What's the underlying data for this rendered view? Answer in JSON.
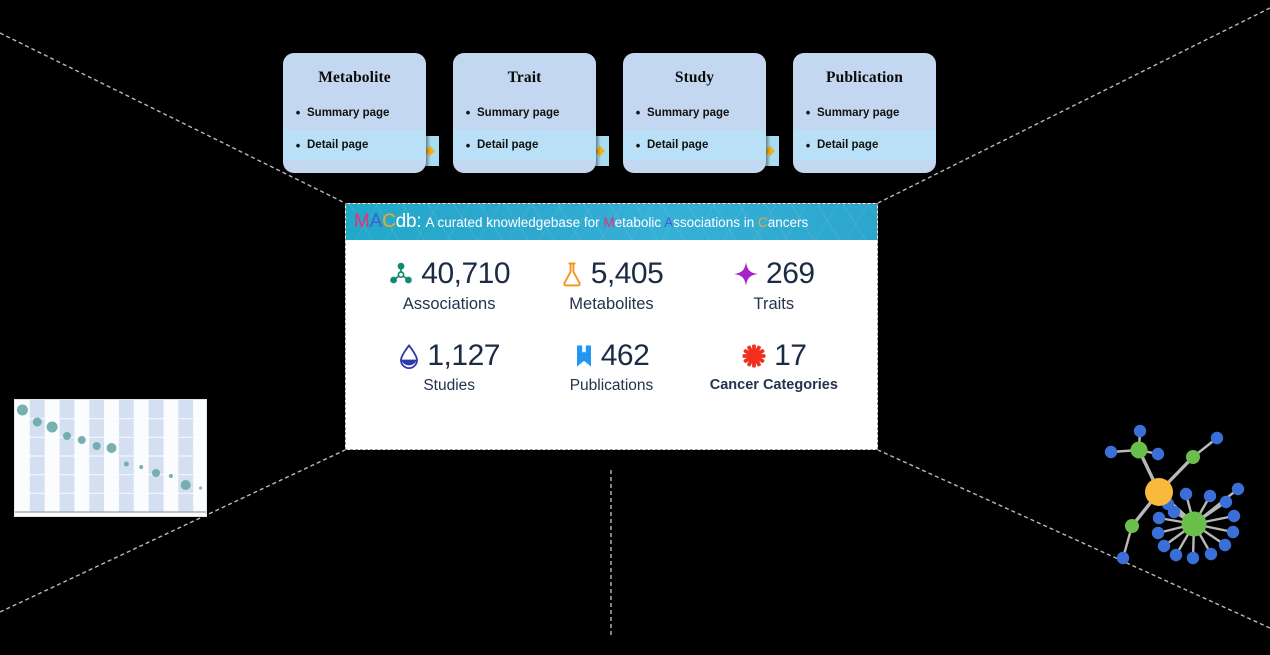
{
  "flow": {
    "arrow_icon": "double-headed-arrow-icon",
    "cards": [
      {
        "title": "Metabolite",
        "summary": "Summary page",
        "detail": "Detail page"
      },
      {
        "title": "Trait",
        "summary": "Summary page",
        "detail": "Detail page"
      },
      {
        "title": "Study",
        "summary": "Summary page",
        "detail": "Detail page"
      },
      {
        "title": "Publication",
        "summary": "Summary page",
        "detail": "Detail page"
      }
    ]
  },
  "panel": {
    "banner": {
      "logo_m": "M",
      "logo_a": "A",
      "logo_c": "C",
      "logo_db": "db:",
      "tagline_pre": "A curated knowledgebase for ",
      "tagline_m": "M",
      "tagline_etabolic": "etabolic ",
      "tagline_a": "A",
      "tagline_ssociations": "ssociations in ",
      "tagline_c": "C",
      "tagline_ancers": "ancers"
    },
    "stats": [
      {
        "value": "40,710",
        "label": "Associations",
        "icon": "molecule-icon",
        "color": "#118a74"
      },
      {
        "value": "5,405",
        "label": "Metabolites",
        "icon": "flask-icon",
        "color": "#f7931e"
      },
      {
        "value": "269",
        "label": "Traits",
        "icon": "sparkle-icon",
        "color": "#a524c6"
      },
      {
        "value": "1,127",
        "label": "Studies",
        "icon": "droplet-icon",
        "color": "#2f3aa8"
      },
      {
        "value": "462",
        "label": "Publications",
        "icon": "bookmark-icon",
        "color": "#2196f3"
      },
      {
        "value": "17",
        "label": "Cancer Categories",
        "icon": "burst-icon",
        "color": "#f0301c"
      }
    ]
  },
  "chart_data": {
    "type": "scatter",
    "title": "",
    "xlabel": "",
    "ylabel": "",
    "grid": true,
    "band_color": "#ccdaf0",
    "dot_color": "#6ba9a8",
    "x": [
      1,
      2,
      3,
      4,
      5,
      6,
      7,
      8,
      9,
      10,
      11,
      12,
      13
    ],
    "y": [
      96,
      84,
      79,
      70,
      66,
      60,
      58,
      42,
      39,
      33,
      30,
      21,
      18
    ],
    "sizes": [
      11,
      9,
      11,
      8,
      8,
      8,
      10,
      5,
      4,
      8,
      4,
      10,
      3
    ]
  },
  "network": {
    "hub_color": "#f8b93c",
    "group_color": "#6abf4b",
    "leaf_color": "#3a6fd8",
    "edge_color": "#b8b8b8",
    "hub_count": 1,
    "group_count": 4,
    "leaf_count": 21
  }
}
